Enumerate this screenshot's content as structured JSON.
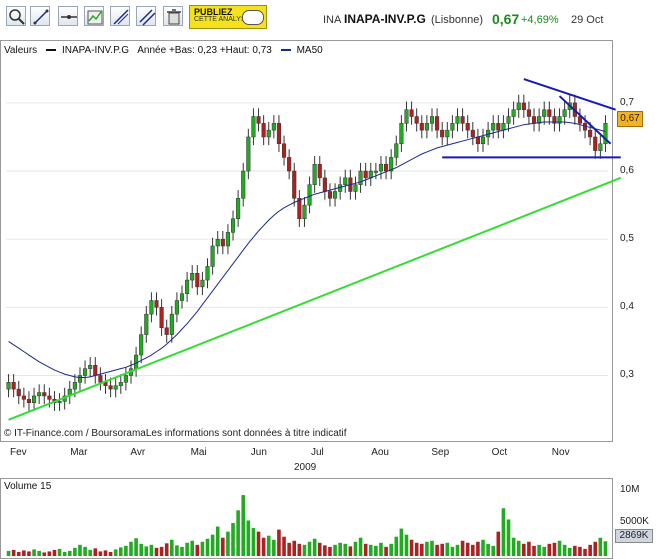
{
  "header": {
    "symbol": "INA",
    "name": "INAPA-INV.P.G",
    "market": "(Lisbonne)",
    "price": "0,67",
    "change": "+4,69%",
    "date": "29 Oct"
  },
  "toolbar": {
    "icons": [
      "zoom-icon",
      "draw-line-icon",
      "horizontal-line-icon",
      "indicator-icon",
      "trend-icon",
      "parallel-icon",
      "delete-icon"
    ],
    "publiez_line1": "PUBLIEZ",
    "publiez_line2": "CETTE ANALYSE"
  },
  "legend": {
    "label": "Valeurs",
    "series_name": "INAPA-INV.P.G",
    "range": "Année +Bas: 0,23 +Haut: 0,73",
    "ma_name": "MA50",
    "colors": {
      "up": "#22aa22",
      "down": "#aa2222",
      "ma": "#1a2a8a",
      "trend_green": "#33dd33",
      "trend_blue": "#1a1ab0"
    }
  },
  "credit": "© IT-Finance.com / BoursoramaLes informations sont données à titre indicatif",
  "year": "2009",
  "price_marker": "0,67",
  "volume": {
    "label": "Volume 15",
    "ticks": [
      "10M",
      "5000K"
    ],
    "current": "2869K"
  },
  "chart_data": {
    "type": "candlestick",
    "ylim": [
      0.22,
      0.76
    ],
    "yticks": [
      {
        "value": 0.7,
        "label": "0,7"
      },
      {
        "value": 0.6,
        "label": "0,6"
      },
      {
        "value": 0.5,
        "label": "0,5"
      },
      {
        "value": 0.4,
        "label": "0,4"
      },
      {
        "value": 0.3,
        "label": "0,3"
      }
    ],
    "months": [
      "Fev",
      "Mar",
      "Avr",
      "Mai",
      "Jun",
      "Jul",
      "Aou",
      "Sep",
      "Oct",
      "Nov"
    ],
    "closes": [
      0.29,
      0.28,
      0.27,
      0.265,
      0.26,
      0.27,
      0.275,
      0.27,
      0.265,
      0.26,
      0.262,
      0.27,
      0.28,
      0.29,
      0.3,
      0.31,
      0.315,
      0.3,
      0.29,
      0.285,
      0.28,
      0.285,
      0.29,
      0.3,
      0.31,
      0.33,
      0.36,
      0.39,
      0.41,
      0.4,
      0.37,
      0.36,
      0.39,
      0.41,
      0.42,
      0.44,
      0.45,
      0.43,
      0.44,
      0.46,
      0.49,
      0.5,
      0.49,
      0.51,
      0.53,
      0.56,
      0.6,
      0.65,
      0.68,
      0.67,
      0.65,
      0.66,
      0.67,
      0.64,
      0.62,
      0.6,
      0.56,
      0.53,
      0.55,
      0.58,
      0.61,
      0.59,
      0.57,
      0.56,
      0.57,
      0.58,
      0.59,
      0.57,
      0.58,
      0.6,
      0.59,
      0.6,
      0.6,
      0.61,
      0.6,
      0.62,
      0.64,
      0.67,
      0.69,
      0.68,
      0.67,
      0.66,
      0.67,
      0.68,
      0.66,
      0.65,
      0.66,
      0.67,
      0.68,
      0.67,
      0.66,
      0.65,
      0.64,
      0.65,
      0.66,
      0.67,
      0.66,
      0.67,
      0.68,
      0.69,
      0.7,
      0.69,
      0.68,
      0.67,
      0.68,
      0.69,
      0.68,
      0.67,
      0.68,
      0.69,
      0.7,
      0.68,
      0.67,
      0.66,
      0.65,
      0.63,
      0.64,
      0.67
    ],
    "ma50": [
      0.35,
      0.345,
      0.34,
      0.335,
      0.33,
      0.325,
      0.32,
      0.316,
      0.312,
      0.308,
      0.305,
      0.302,
      0.3,
      0.298,
      0.297,
      0.297,
      0.298,
      0.3,
      0.302,
      0.304,
      0.306,
      0.308,
      0.31,
      0.312,
      0.315,
      0.318,
      0.322,
      0.326,
      0.33,
      0.335,
      0.34,
      0.346,
      0.353,
      0.36,
      0.368,
      0.376,
      0.385,
      0.394,
      0.404,
      0.414,
      0.424,
      0.434,
      0.444,
      0.454,
      0.464,
      0.474,
      0.484,
      0.494,
      0.503,
      0.512,
      0.52,
      0.528,
      0.535,
      0.541,
      0.546,
      0.55,
      0.554,
      0.557,
      0.56,
      0.563,
      0.566,
      0.568,
      0.57,
      0.572,
      0.574,
      0.576,
      0.578,
      0.58,
      0.582,
      0.584,
      0.587,
      0.59,
      0.593,
      0.596,
      0.599,
      0.602,
      0.605,
      0.609,
      0.613,
      0.617,
      0.621,
      0.625,
      0.628,
      0.631,
      0.634,
      0.636,
      0.638,
      0.64,
      0.642,
      0.644,
      0.646,
      0.648,
      0.65,
      0.652,
      0.654,
      0.656,
      0.658,
      0.66,
      0.662,
      0.664,
      0.666,
      0.668,
      0.669,
      0.67,
      0.671,
      0.672,
      0.672,
      0.672,
      0.672,
      0.672,
      0.671,
      0.67,
      0.668,
      0.666,
      0.664,
      0.662,
      0.66,
      0.658
    ],
    "volumes": [
      1,
      1.2,
      0.8,
      1.1,
      0.9,
      1.3,
      1,
      0.7,
      0.9,
      1.2,
      1.4,
      0.8,
      1,
      1.6,
      2.2,
      1.8,
      1.2,
      1.5,
      0.9,
      1.1,
      0.8,
      1.3,
      1.7,
      2,
      2.8,
      3.5,
      2.4,
      1.9,
      2.2,
      1.6,
      1.8,
      2.5,
      3.2,
      2.1,
      1.8,
      2.6,
      3,
      2.2,
      2.8,
      3.4,
      4.2,
      5.8,
      3.6,
      4.8,
      6.5,
      9,
      12,
      7,
      5.5,
      4.8,
      3.6,
      4,
      3.2,
      5.2,
      3.8,
      2.6,
      3,
      2.4,
      2.2,
      2.8,
      3.4,
      2.6,
      2.1,
      1.8,
      2.2,
      2.6,
      2.4,
      1.9,
      2.8,
      3.6,
      2.4,
      2.2,
      2,
      2.6,
      1.8,
      2.4,
      3.8,
      5.4,
      4.2,
      3.2,
      2.6,
      2.4,
      2.8,
      3,
      2.2,
      2.4,
      2.6,
      1.8,
      2.2,
      3,
      2.6,
      2.2,
      2.8,
      3.2,
      2.4,
      2,
      4.8,
      9.4,
      7.2,
      3.6,
      3,
      2.4,
      2.8,
      2,
      2.2,
      1.8,
      2.4,
      2.6,
      3,
      2.2,
      1.6,
      2,
      1.8,
      1.4,
      2.2,
      2.8,
      3.6,
      2.9
    ],
    "trendlines": [
      {
        "color": "trend_green",
        "from": [
          0,
          0.235
        ],
        "to": [
          120,
          0.59
        ]
      },
      {
        "color": "trend_blue",
        "from": [
          85,
          0.62
        ],
        "to": [
          120,
          0.62
        ]
      },
      {
        "color": "trend_blue",
        "from": [
          101,
          0.735
        ],
        "to": [
          119,
          0.69
        ]
      },
      {
        "color": "trend_blue",
        "from": [
          108,
          0.71
        ],
        "to": [
          118,
          0.64
        ]
      }
    ]
  }
}
